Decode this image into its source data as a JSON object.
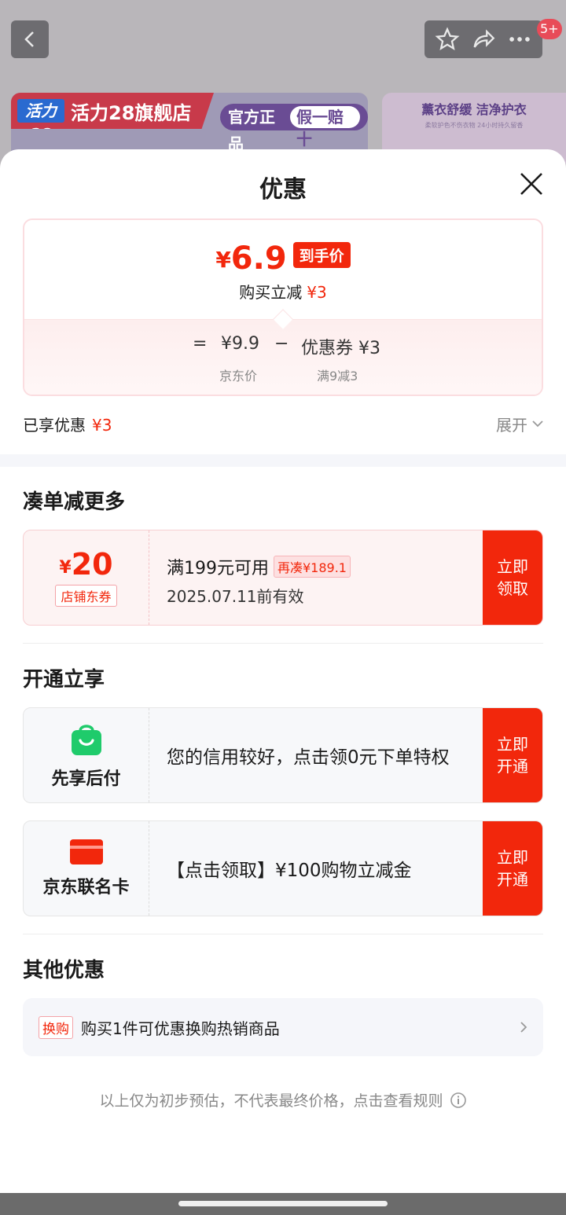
{
  "background": {
    "badge": "5+",
    "banner": {
      "logo": "活力28",
      "brand": "活力28旗舰店",
      "tag1": "官方正品",
      "tag2": "假一赔十"
    },
    "card2": {
      "title": "薰衣舒缓 洁净护衣",
      "subtitle": "柔软护色不伤衣物 24小时持久留香"
    }
  },
  "sheet": {
    "title": "优惠",
    "price": {
      "symbol": "¥",
      "value": "6.9",
      "tag": "到手价",
      "sub_label": "购买立减",
      "sub_value": "¥3"
    },
    "equation": {
      "equals": "=",
      "base_price": "¥9.9",
      "minus": "−",
      "coupon": "优惠券 ¥3",
      "base_label": "京东价",
      "coupon_label": "满9减3"
    },
    "enjoyed": {
      "label": "已享优惠",
      "value": "¥3",
      "expand": "展开"
    }
  },
  "more": {
    "title": "凑单减更多",
    "coupon": {
      "symbol": "¥",
      "value": "20",
      "type": "店铺东券",
      "condition": "满199元可用",
      "tag": "再凑¥189.1",
      "date": "2025.07.11前有效",
      "button": "立即领取"
    }
  },
  "open": {
    "title": "开通立享",
    "items": [
      {
        "label": "先享后付",
        "text": "您的信用较好，点击领0元下单特权",
        "button": "立即开通"
      },
      {
        "label": "京东联名卡",
        "text": "【点击领取】¥100购物立减金",
        "button": "立即开通"
      }
    ]
  },
  "other": {
    "title": "其他优惠",
    "tag": "换购",
    "text": "购买1件可优惠换购热销商品"
  },
  "disclaimer": "以上仅为初步预估，不代表最终价格，点击查看规则",
  "colors": {
    "accent": "#f2270c",
    "green": "#1fcb6b"
  }
}
